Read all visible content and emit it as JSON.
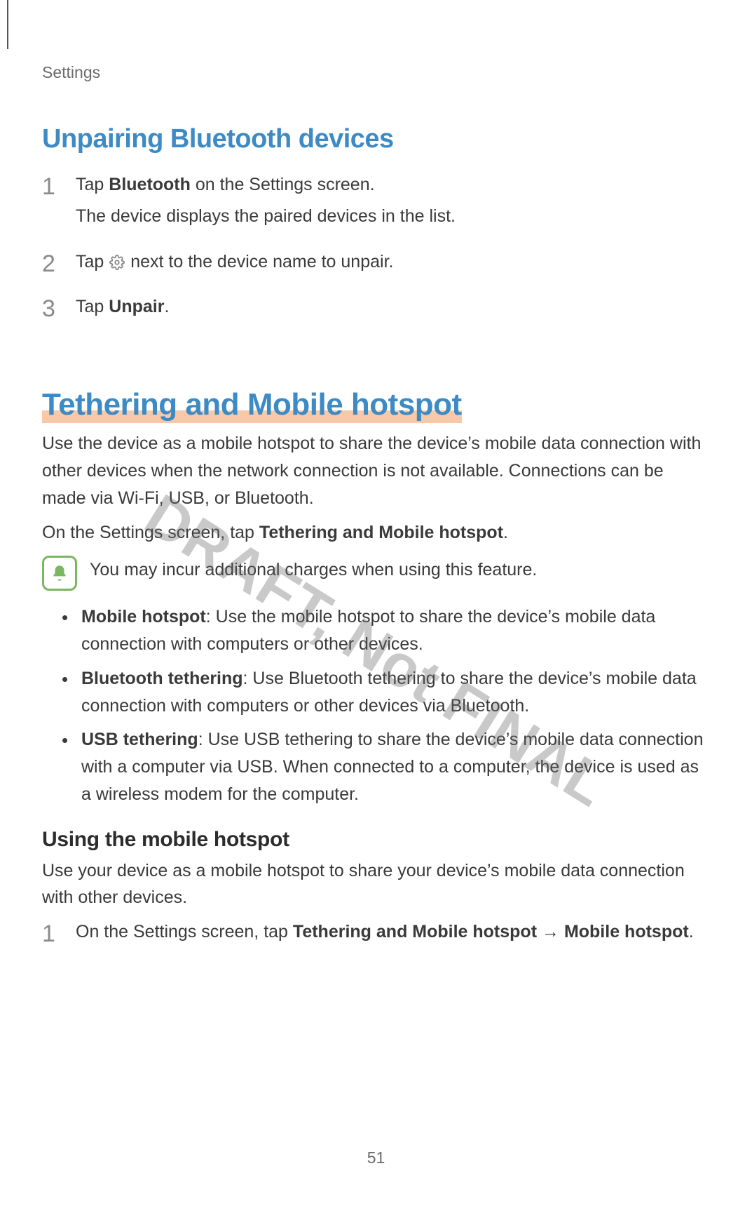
{
  "breadcrumb": "Settings",
  "unpair": {
    "heading": "Unpairing Bluetooth devices",
    "step1_text_before": "Tap ",
    "step1_bold": "Bluetooth",
    "step1_text_after": " on the Settings screen.",
    "step1_sub": "The device displays the paired devices in the list.",
    "step2_before": "Tap ",
    "step2_after": " next to the device name to unpair.",
    "step3_before": "Tap ",
    "step3_bold": "Unpair",
    "step3_after": "."
  },
  "tethering": {
    "heading": "Tethering and Mobile hotspot",
    "intro": "Use the device as a mobile hotspot to share the device’s mobile data connection with other devices when the network connection is not available. Connections can be made via Wi-Fi, USB, or Bluetooth.",
    "nav_before": "On the Settings screen, tap ",
    "nav_bold": "Tethering and Mobile hotspot",
    "nav_after": ".",
    "note": "You may incur additional charges when using this feature.",
    "bullets": {
      "b1_bold": "Mobile hotspot",
      "b1_rest": ": Use the mobile hotspot to share the device’s mobile data connection with computers or other devices.",
      "b2_bold": "Bluetooth tethering",
      "b2_rest": ": Use Bluetooth tethering to share the device’s mobile data connection with computers or other devices via Bluetooth.",
      "b3_bold": "USB tethering",
      "b3_rest": ": Use USB tethering to share the device’s mobile data connection with a computer via USB. When connected to a computer, the device is used as a wireless modem for the computer."
    },
    "using_heading": "Using the mobile hotspot",
    "using_body": "Use your device as a mobile hotspot to share your device’s mobile data connection with other devices.",
    "using_step1_before": "On the Settings screen, tap ",
    "using_step1_bold1": "Tethering and Mobile hotspot",
    "using_step1_arrow": " → ",
    "using_step1_bold2": "Mobile hotspot",
    "using_step1_after": "."
  },
  "watermark": "DRAFT, Not FINAL",
  "page_number": "51"
}
